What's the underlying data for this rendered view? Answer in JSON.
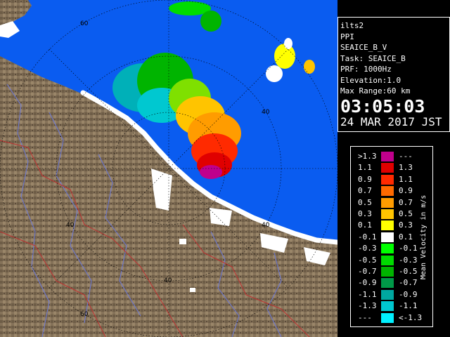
{
  "info_panel": {
    "site": "ilts2",
    "product": "PPI",
    "scan": "SEAICE_B_V",
    "task": "Task: SEAICE_B",
    "prf": "PRF: 1000Hz",
    "elevation": "Elevation:1.0",
    "max_range": "Max Range:60 km",
    "time": "03:05:03",
    "date": "24 MAR 2017 JST"
  },
  "range_ring_labels": [
    "60",
    "40",
    "40",
    "40",
    "40",
    "60"
  ],
  "legend": {
    "title": "Mean Velocity in m/s",
    "rows": [
      {
        "low": ">1.3",
        "high": "---",
        "color": "#c0008c"
      },
      {
        "low": "1.1",
        "high": "1.3",
        "color": "#e00000"
      },
      {
        "low": "0.9",
        "high": "1.1",
        "color": "#ff2a00"
      },
      {
        "low": "0.7",
        "high": "0.9",
        "color": "#ff6a00"
      },
      {
        "low": "0.5",
        "high": "0.7",
        "color": "#ff9c00"
      },
      {
        "low": "0.3",
        "high": "0.5",
        "color": "#ffc400"
      },
      {
        "low": "0.1",
        "high": "0.3",
        "color": "#ffff00"
      },
      {
        "low": "-0.1",
        "high": "0.1",
        "color": "#ffffff"
      },
      {
        "low": "-0.3",
        "high": "-0.1",
        "color": "#00ff00"
      },
      {
        "low": "-0.5",
        "high": "-0.3",
        "color": "#00dc00"
      },
      {
        "low": "-0.7",
        "high": "-0.5",
        "color": "#00b400"
      },
      {
        "low": "-0.9",
        "high": "-0.7",
        "color": "#009a48"
      },
      {
        "low": "-1.1",
        "high": "-0.9",
        "color": "#00a8a0"
      },
      {
        "low": "-1.3",
        "high": "-1.1",
        "color": "#00c8d0"
      },
      {
        "low": "---",
        "high": "<-1.3",
        "color": "#00f0ff"
      }
    ]
  },
  "colors": {
    "sea": "#0a5cf0",
    "land": "#85735a",
    "land_dark": "#5e4f3c",
    "ice": "#ffffff",
    "ring": "#000000",
    "rivers": "#6a78d8",
    "borders": "#c03030"
  }
}
